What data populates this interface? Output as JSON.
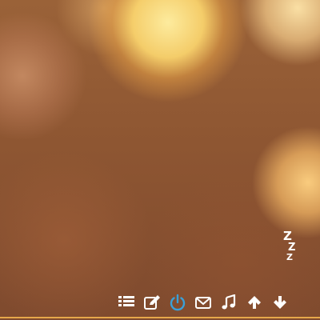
{
  "wallpaper": {
    "description_icon": "bokeh-wallpaper"
  },
  "sleep_widget": {
    "icon": "moon-zzz-icon",
    "letters": [
      "Z",
      "Z",
      "Z"
    ],
    "color": "#ffffff"
  },
  "toolbar": {
    "icon_color": "#ffffff",
    "active_color": "#3aa0d8",
    "buttons": [
      {
        "icon": "list-icon"
      },
      {
        "icon": "edit-icon"
      },
      {
        "icon": "power-icon"
      },
      {
        "icon": "mail-icon"
      },
      {
        "icon": "music-icon"
      },
      {
        "icon": "arrow-up-icon"
      },
      {
        "icon": "arrow-down-icon"
      }
    ]
  },
  "colors": {
    "accent_rule": "#e6a74a"
  }
}
